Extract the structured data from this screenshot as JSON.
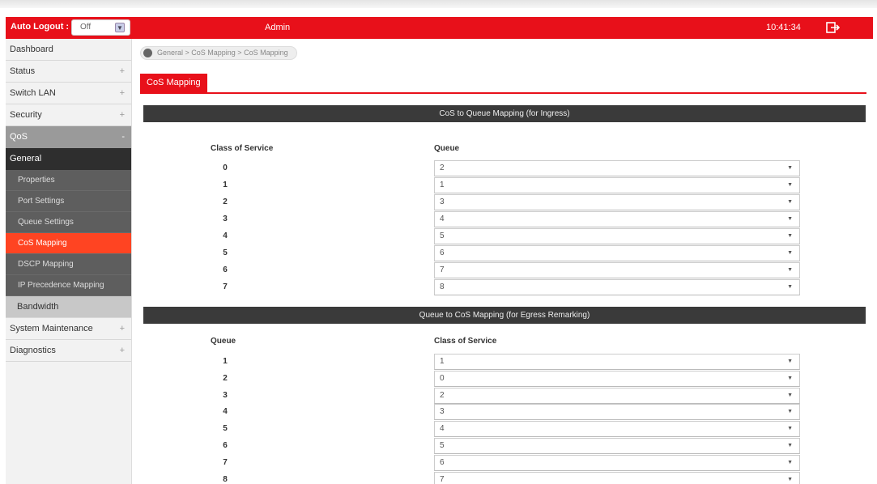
{
  "header": {
    "auto_logout_label": "Auto Logout :",
    "auto_logout_value": "Off",
    "user": "Admin",
    "clock": "10:41:34"
  },
  "sidebar": {
    "items_top": [
      {
        "label": "Dashboard",
        "expander": ""
      },
      {
        "label": "Status",
        "expander": "+"
      },
      {
        "label": "Switch LAN",
        "expander": "+"
      },
      {
        "label": "Security",
        "expander": "+"
      },
      {
        "label": "QoS",
        "expander": "-"
      }
    ],
    "general_label": "General",
    "sub_items": [
      {
        "label": "Properties"
      },
      {
        "label": "Port Settings"
      },
      {
        "label": "Queue Settings"
      },
      {
        "label": "CoS Mapping"
      },
      {
        "label": "DSCP Mapping"
      },
      {
        "label": "IP Precedence Mapping"
      }
    ],
    "bandwidth_label": "Bandwidth",
    "items_bottom": [
      {
        "label": "System Maintenance",
        "expander": "+"
      },
      {
        "label": "Diagnostics",
        "expander": "+"
      }
    ]
  },
  "breadcrumb": "General > CoS Mapping > CoS Mapping",
  "tab": "CoS Mapping",
  "ingress": {
    "title": "CoS to Queue Mapping (for Ingress)",
    "col1": "Class of Service",
    "col2": "Queue",
    "rows": [
      {
        "label": "0",
        "value": "2"
      },
      {
        "label": "1",
        "value": "1"
      },
      {
        "label": "2",
        "value": "3"
      },
      {
        "label": "3",
        "value": "4"
      },
      {
        "label": "4",
        "value": "5"
      },
      {
        "label": "5",
        "value": "6"
      },
      {
        "label": "6",
        "value": "7"
      },
      {
        "label": "7",
        "value": "8"
      }
    ]
  },
  "egress": {
    "title": "Queue to CoS Mapping (for Egress Remarking)",
    "col1": "Queue",
    "col2": "Class of Service",
    "rows": [
      {
        "label": "1",
        "value": "1"
      },
      {
        "label": "2",
        "value": "0"
      },
      {
        "label": "3",
        "value": "2"
      },
      {
        "label": "4",
        "value": "3"
      },
      {
        "label": "5",
        "value": "4"
      },
      {
        "label": "6",
        "value": "5"
      },
      {
        "label": "7",
        "value": "6"
      },
      {
        "label": "8",
        "value": "7"
      }
    ]
  }
}
